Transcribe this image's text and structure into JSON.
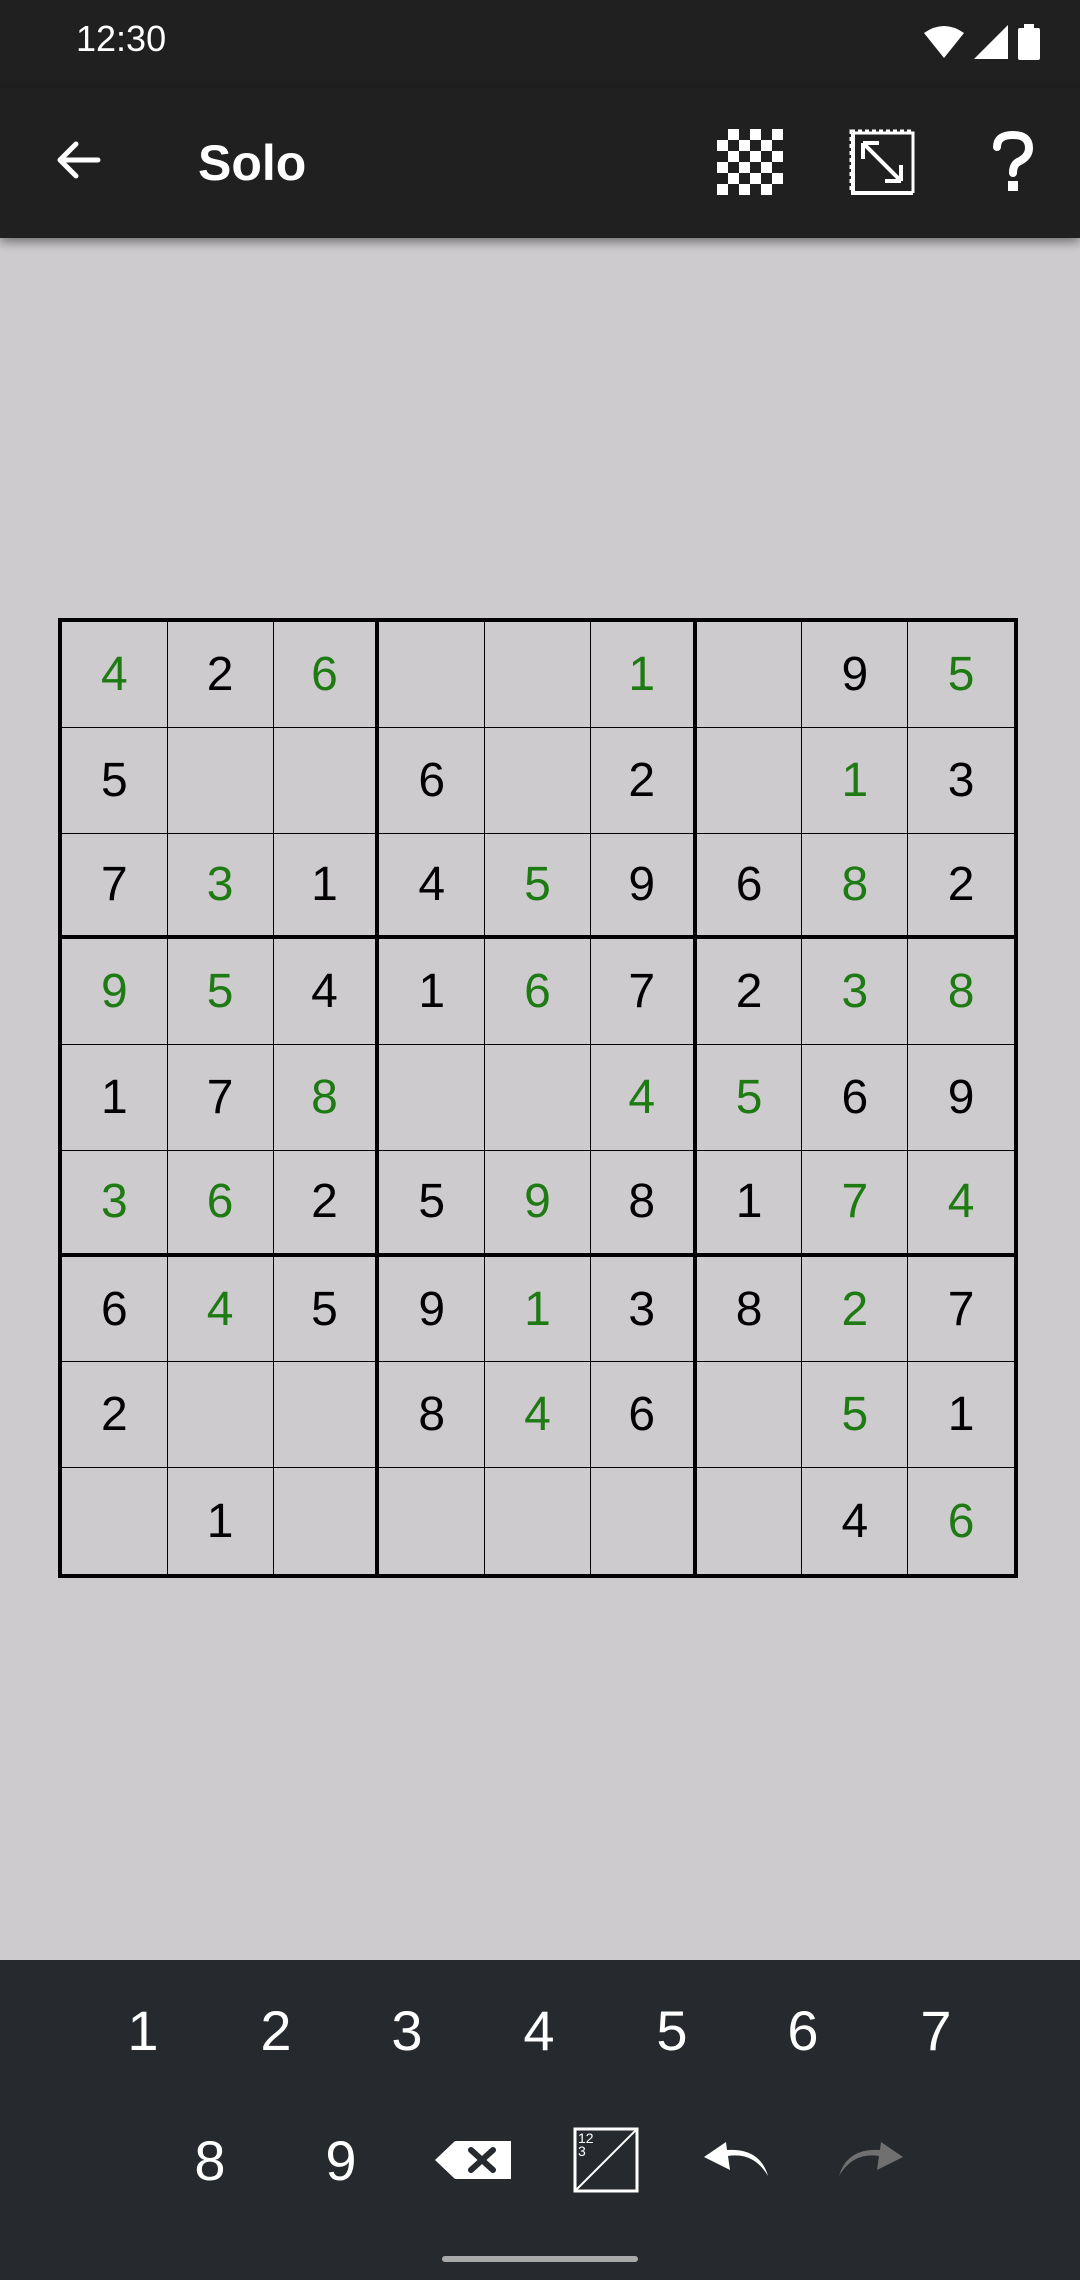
{
  "status": {
    "time": "12:30"
  },
  "toolbar": {
    "title": "Solo",
    "icons": [
      "back-arrow-icon",
      "checkerboard-icon",
      "resize-icon",
      "help-icon"
    ]
  },
  "board": {
    "cells": [
      [
        "4",
        "2",
        "6",
        "",
        "",
        "1",
        "",
        "9",
        "5"
      ],
      [
        "5",
        "",
        "",
        "6",
        "",
        "2",
        "",
        "1",
        "3"
      ],
      [
        "7",
        "3",
        "1",
        "4",
        "5",
        "9",
        "6",
        "8",
        "2"
      ],
      [
        "9",
        "5",
        "4",
        "1",
        "6",
        "7",
        "2",
        "3",
        "8"
      ],
      [
        "1",
        "7",
        "8",
        "",
        "",
        "4",
        "5",
        "6",
        "9"
      ],
      [
        "3",
        "6",
        "2",
        "5",
        "9",
        "8",
        "1",
        "7",
        "4"
      ],
      [
        "6",
        "4",
        "5",
        "9",
        "1",
        "3",
        "8",
        "2",
        "7"
      ],
      [
        "2",
        "",
        "",
        "8",
        "4",
        "6",
        "",
        "5",
        "1"
      ],
      [
        "",
        "1",
        "",
        "",
        "",
        "",
        "",
        "4",
        "6"
      ]
    ],
    "entered": [
      [
        1,
        0,
        1,
        0,
        0,
        1,
        0,
        0,
        1
      ],
      [
        0,
        0,
        0,
        0,
        0,
        0,
        0,
        1,
        0
      ],
      [
        0,
        1,
        0,
        0,
        1,
        0,
        0,
        1,
        0
      ],
      [
        1,
        1,
        0,
        0,
        1,
        0,
        0,
        1,
        1
      ],
      [
        0,
        0,
        1,
        0,
        0,
        1,
        1,
        0,
        0
      ],
      [
        1,
        1,
        0,
        0,
        1,
        0,
        0,
        1,
        1
      ],
      [
        0,
        1,
        0,
        0,
        1,
        0,
        0,
        1,
        0
      ],
      [
        0,
        0,
        0,
        0,
        1,
        0,
        0,
        1,
        0
      ],
      [
        0,
        0,
        0,
        0,
        0,
        0,
        0,
        0,
        1
      ]
    ],
    "colors": {
      "given": "#000000",
      "entered": "#1e7a12",
      "background": "#cdcbce"
    }
  },
  "keypad": {
    "digits": [
      "1",
      "2",
      "3",
      "4",
      "5",
      "6",
      "7",
      "8",
      "9"
    ],
    "actions": [
      "backspace-icon",
      "pencil-mark-icon",
      "undo-icon",
      "redo-icon"
    ]
  }
}
